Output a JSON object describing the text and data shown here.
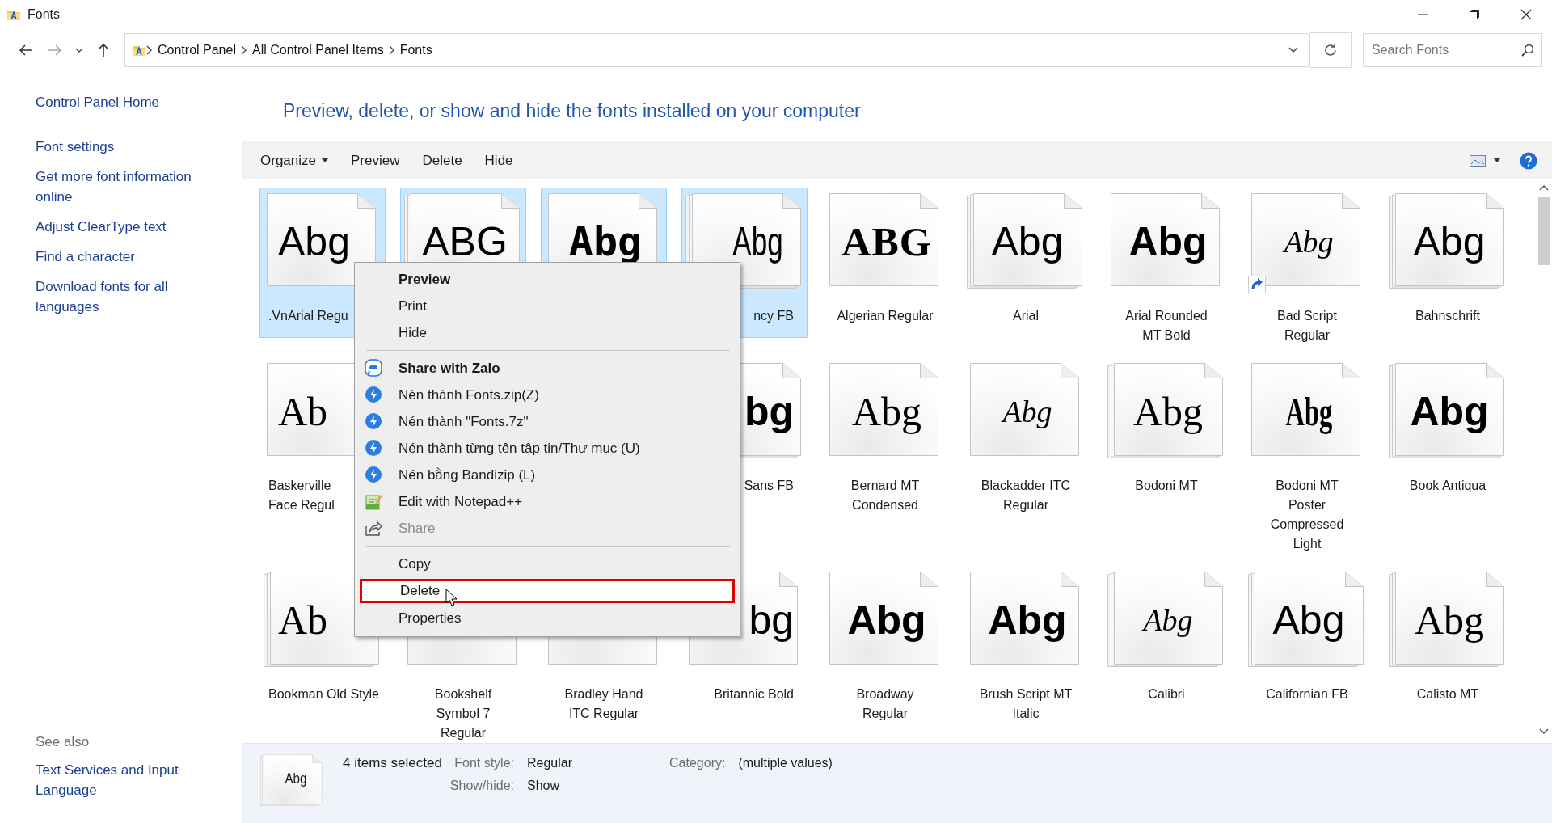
{
  "window": {
    "title": "Fonts"
  },
  "address": {
    "crumbs": [
      "Control Panel",
      "All Control Panel Items",
      "Fonts"
    ]
  },
  "search": {
    "placeholder": "Search Fonts"
  },
  "sidebar": {
    "home": "Control Panel Home",
    "links": [
      "Font settings",
      "Get more font information online",
      "Adjust ClearType text",
      "Find a character",
      "Download fonts for all languages"
    ],
    "see_also_title": "See also",
    "see_also": [
      "Text Services and Input Language"
    ]
  },
  "heading": "Preview, delete, or show and hide the fonts installed on your computer",
  "toolbar": [
    {
      "label": "Organize",
      "dropdown": true
    },
    {
      "label": "Preview",
      "dropdown": false
    },
    {
      "label": "Delete",
      "dropdown": false
    },
    {
      "label": "Hide",
      "dropdown": false
    }
  ],
  "tiles": [
    {
      "kind": "font",
      "sample": "Abg",
      "label": ".VnArial Regu",
      "cut_right": true,
      "cut_left": false,
      "selected": true,
      "stacked": false,
      "shortcut": false
    },
    {
      "kind": "font",
      "sample": "ABG",
      "selected": true,
      "stacked": true,
      "shortcut": false
    },
    {
      "kind": "font",
      "sample": "Abg",
      "selected": true,
      "stacked": false,
      "shortcut": false
    },
    {
      "kind": "font",
      "sample": "Abg",
      "label": "ncy FB",
      "cut_right": false,
      "cut_left": true,
      "selected": true,
      "stacked": true,
      "shortcut": false
    },
    {
      "kind": "font",
      "sample": "ABG",
      "label": "Algerian Regular",
      "cut_right": false,
      "cut_left": false,
      "selected": false,
      "stacked": false,
      "shortcut": false
    },
    {
      "kind": "font",
      "sample": "Abg",
      "label": "Arial",
      "cut_right": false,
      "cut_left": false,
      "selected": false,
      "stacked": true,
      "shortcut": false
    },
    {
      "kind": "font",
      "sample": "Abg",
      "label": "Arial Rounded MT Bold",
      "cut_right": false,
      "cut_left": false,
      "selected": false,
      "stacked": false,
      "shortcut": false
    },
    {
      "kind": "font",
      "sample": "Abg",
      "label": "Bad Script Regular",
      "cut_right": false,
      "cut_left": false,
      "selected": false,
      "stacked": false,
      "shortcut": true
    },
    {
      "kind": "font",
      "sample": "Abg",
      "label": "Bahnschrift",
      "cut_right": false,
      "cut_left": false,
      "selected": false,
      "stacked": true,
      "shortcut": false
    },
    {
      "kind": "font",
      "sample": "Ab",
      "label": "Baskerville\nFace Regul",
      "cut_right": true,
      "cut_left": false,
      "selected": false,
      "stacked": false,
      "shortcut": false
    },
    {
      "kind": "covered"
    },
    {
      "kind": "covered"
    },
    {
      "kind": "font",
      "sample": "bg",
      "label": "Sans FB",
      "cut_right": false,
      "cut_left": true,
      "selected": false,
      "stacked": true,
      "shortcut": false
    },
    {
      "kind": "font",
      "sample": "Abg",
      "label": "Bernard MT Condensed",
      "cut_right": false,
      "cut_left": false,
      "selected": false,
      "stacked": false,
      "shortcut": false
    },
    {
      "kind": "font",
      "sample": "Abg",
      "label": "Blackadder ITC Regular",
      "cut_right": false,
      "cut_left": false,
      "selected": false,
      "stacked": false,
      "shortcut": false
    },
    {
      "kind": "font",
      "sample": "Abg",
      "label": "Bodoni MT",
      "cut_right": false,
      "cut_left": false,
      "selected": false,
      "stacked": true,
      "shortcut": false
    },
    {
      "kind": "font",
      "sample": "Abg",
      "label": "Bodoni MT Poster Compressed Light",
      "cut_right": false,
      "cut_left": false,
      "selected": false,
      "stacked": false,
      "shortcut": false
    },
    {
      "kind": "font",
      "sample": "Abg",
      "label": "Book Antiqua",
      "cut_right": false,
      "cut_left": false,
      "selected": false,
      "stacked": true,
      "shortcut": false
    },
    {
      "kind": "font",
      "sample": "Ab",
      "label": "Bookman Old Style",
      "cut_right": true,
      "cut_left": false,
      "selected": false,
      "stacked": true,
      "shortcut": false
    },
    {
      "kind": "font",
      "label": "Bookshelf Symbol 7 Regular",
      "cut_right": false,
      "cut_left": false,
      "selected": false
    },
    {
      "kind": "font",
      "label": "Bradley Hand ITC Regular",
      "cut_right": false,
      "cut_left": false,
      "selected": false
    },
    {
      "kind": "font",
      "sample": "bg",
      "label": "Britannic Bold",
      "cut_right": false,
      "cut_left": true,
      "selected": false,
      "stacked": false,
      "shortcut": false
    },
    {
      "kind": "font",
      "sample": "Abg",
      "label": "Broadway Regular",
      "cut_right": false,
      "cut_left": false,
      "selected": false,
      "stacked": false,
      "shortcut": false
    },
    {
      "kind": "font",
      "sample": "Abg",
      "label": "Brush Script MT Italic",
      "cut_right": false,
      "cut_left": false,
      "selected": false,
      "stacked": false,
      "shortcut": false
    },
    {
      "kind": "font",
      "sample": "Abg",
      "label": "Calibri",
      "cut_right": false,
      "cut_left": false,
      "selected": false,
      "stacked": true,
      "shortcut": false
    },
    {
      "kind": "font",
      "sample": "Abg",
      "label": "Californian FB",
      "cut_right": false,
      "cut_left": false,
      "selected": false,
      "stacked": true,
      "shortcut": false
    },
    {
      "kind": "font",
      "sample": "Abg",
      "label": "Calisto MT",
      "cut_right": false,
      "cut_left": false,
      "selected": false,
      "stacked": true,
      "shortcut": false
    }
  ],
  "context_menu": [
    {
      "kind": "item",
      "label": "Preview",
      "bold": true,
      "disabled": false,
      "highlighted": false
    },
    {
      "kind": "item",
      "label": "Print",
      "bold": false,
      "disabled": false,
      "highlighted": false
    },
    {
      "kind": "item",
      "label": "Hide",
      "bold": false,
      "disabled": false,
      "highlighted": false
    },
    {
      "kind": "separator"
    },
    {
      "kind": "item",
      "label": "Share with Zalo",
      "bold": true,
      "disabled": false,
      "highlighted": false
    },
    {
      "kind": "item",
      "label": "Nén thành Fonts.zip(Z)",
      "bold": false,
      "disabled": false,
      "highlighted": false
    },
    {
      "kind": "item",
      "label": "Nén thành \"Fonts.7z\"",
      "bold": false,
      "disabled": false,
      "highlighted": false
    },
    {
      "kind": "item",
      "label": "Nén thành từng tên tập tin/Thư mục (U)",
      "bold": false,
      "disabled": false,
      "highlighted": false
    },
    {
      "kind": "item",
      "label": "Nén bằng Bandizip (L)",
      "bold": false,
      "disabled": false,
      "highlighted": false
    },
    {
      "kind": "item",
      "label": "Edit with Notepad++",
      "bold": false,
      "disabled": false,
      "highlighted": false
    },
    {
      "kind": "item",
      "label": "Share",
      "bold": false,
      "disabled": true,
      "highlighted": false
    },
    {
      "kind": "separator"
    },
    {
      "kind": "item",
      "label": "Copy",
      "bold": false,
      "disabled": false,
      "highlighted": false
    },
    {
      "kind": "item",
      "label": "Delete",
      "bold": false,
      "disabled": false,
      "highlighted": true
    },
    {
      "kind": "item",
      "label": "Properties",
      "bold": false,
      "disabled": false,
      "highlighted": false
    }
  ],
  "details": {
    "sample": "Abg",
    "count": "4 items selected",
    "properties": [
      {
        "label": "Font style:",
        "value": "Regular"
      },
      {
        "label": "Show/hide:",
        "value": "Show"
      },
      {
        "label": "Category:",
        "value": "(multiple values)"
      }
    ]
  }
}
